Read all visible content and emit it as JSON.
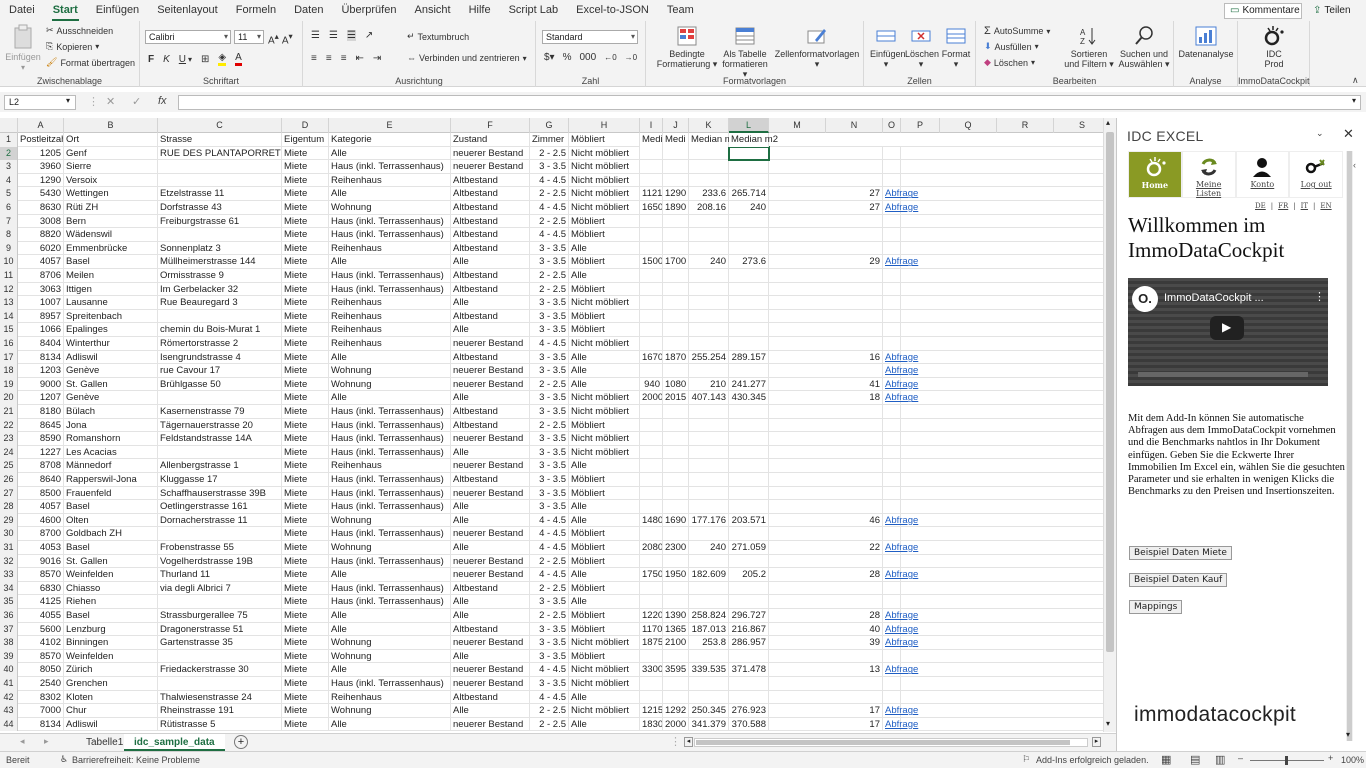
{
  "menu": {
    "tabs": [
      "Datei",
      "Start",
      "Einfügen",
      "Seitenlayout",
      "Formeln",
      "Daten",
      "Überprüfen",
      "Ansicht",
      "Hilfe",
      "Script Lab",
      "Excel-to-JSON",
      "Team"
    ],
    "active": "Start",
    "comments_label": "Kommentare",
    "share_label": "Teilen"
  },
  "ribbon": {
    "clipboard": {
      "paste": "Einfügen",
      "cut": "Ausschneiden",
      "copy": "Kopieren",
      "painter": "Format übertragen",
      "label": "Zwischenablage"
    },
    "font": {
      "name": "Calibri",
      "size": "11",
      "bold": "F",
      "italic": "K",
      "underline": "U",
      "label": "Schriftart"
    },
    "alignment": {
      "wrap": "Textumbruch",
      "merge": "Verbinden und zentrieren",
      "label": "Ausrichtung"
    },
    "number": {
      "format": "Standard",
      "label": "Zahl"
    },
    "styles": {
      "conditional": "Bedingte Formatierung",
      "table": "Als Tabelle formatieren",
      "cell": "Zellenformatvorlagen",
      "label": "Formatvorlagen"
    },
    "cells": {
      "insert": "Einfügen",
      "delete": "Löschen",
      "format": "Format",
      "label": "Zellen"
    },
    "editing": {
      "autosum": "AutoSumme",
      "fill": "Ausfüllen",
      "clear": "Löschen",
      "sort": "Sortieren und Filtern",
      "find": "Suchen und Auswählen",
      "label": "Bearbeiten"
    },
    "analysis": {
      "data": "Datenanalyse",
      "label": "Analyse"
    },
    "idc": {
      "btn": "IDC Prod",
      "label": "ImmoDataCockpit"
    }
  },
  "formula_bar": {
    "namebox": "L2",
    "fx": "fx",
    "value": ""
  },
  "columns": [
    "A",
    "B",
    "C",
    "D",
    "E",
    "F",
    "G",
    "H",
    "I",
    "J",
    "K",
    "L",
    "M",
    "N",
    "O",
    "P",
    "Q",
    "R",
    "S"
  ],
  "selected_cell": "L2",
  "headers": [
    "Postleitzahl",
    "Ort",
    "Strasse",
    "Eigentum",
    "Kategorie",
    "Zustand",
    "Zimmer",
    "Möbliert",
    "Medi",
    "Medi",
    "Median m",
    "Median m2"
  ],
  "rows": [
    [
      "1205",
      "Genf",
      "RUE DES PLANTAPORRETS 7",
      "Miete",
      "Alle",
      "neuerer Bestand",
      "2 - 2.5",
      "Nicht möbliert",
      "",
      "",
      "",
      "",
      "",
      ""
    ],
    [
      "3960",
      "Sierre",
      "",
      "Miete",
      "Haus (inkl. Terrassenhaus)",
      "neuerer Bestand",
      "3 - 3.5",
      "Nicht möbliert",
      "",
      "",
      "",
      "",
      "",
      ""
    ],
    [
      "1290",
      "Versoix",
      "",
      "Miete",
      "Reihenhaus",
      "Altbestand",
      "4 - 4.5",
      "Nicht möbliert",
      "",
      "",
      "",
      "",
      "",
      ""
    ],
    [
      "5430",
      "Wettingen",
      "Etzelstrasse 11",
      "Miete",
      "Alle",
      "Altbestand",
      "2 - 2.5",
      "Nicht möbliert",
      "1121",
      "1290",
      "233.6",
      "265.714",
      "27",
      "Abfrage"
    ],
    [
      "8630",
      "Rüti ZH",
      "Dorfstrasse 43",
      "Miete",
      "Wohnung",
      "Altbestand",
      "4 - 4.5",
      "Nicht möbliert",
      "1650",
      "1890",
      "208.16",
      "240",
      "27",
      "Abfrage"
    ],
    [
      "3008",
      "Bern",
      "Freiburgstrasse 61",
      "Miete",
      "Haus (inkl. Terrassenhaus)",
      "Altbestand",
      "2 - 2.5",
      "Möbliert",
      "",
      "",
      "",
      "",
      "",
      ""
    ],
    [
      "8820",
      "Wädenswil",
      "",
      "Miete",
      "Haus (inkl. Terrassenhaus)",
      "Altbestand",
      "4 - 4.5",
      "Möbliert",
      "",
      "",
      "",
      "",
      "",
      ""
    ],
    [
      "6020",
      "Emmenbrücke",
      "Sonnenplatz 3",
      "Miete",
      "Reihenhaus",
      "Altbestand",
      "3 - 3.5",
      "Alle",
      "",
      "",
      "",
      "",
      "",
      ""
    ],
    [
      "4057",
      "Basel",
      "Müllheimerstrasse 144",
      "Miete",
      "Alle",
      "Alle",
      "3 - 3.5",
      "Möbliert",
      "1500",
      "1700",
      "240",
      "273.6",
      "29",
      "Abfrage"
    ],
    [
      "8706",
      "Meilen",
      "Ormisstrasse 9",
      "Miete",
      "Haus (inkl. Terrassenhaus)",
      "Altbestand",
      "2 - 2.5",
      "Alle",
      "",
      "",
      "",
      "",
      "",
      ""
    ],
    [
      "3063",
      "Ittigen",
      "Im Gerbelacker 32",
      "Miete",
      "Haus (inkl. Terrassenhaus)",
      "Altbestand",
      "2 - 2.5",
      "Möbliert",
      "",
      "",
      "",
      "",
      "",
      ""
    ],
    [
      "1007",
      "Lausanne",
      "Rue Beauregard 3",
      "Miete",
      "Reihenhaus",
      "Alle",
      "3 - 3.5",
      "Nicht möbliert",
      "",
      "",
      "",
      "",
      "",
      ""
    ],
    [
      "8957",
      "Spreitenbach",
      "",
      "Miete",
      "Reihenhaus",
      "Altbestand",
      "3 - 3.5",
      "Möbliert",
      "",
      "",
      "",
      "",
      "",
      ""
    ],
    [
      "1066",
      "Epalinges",
      "chemin du Bois-Murat 1",
      "Miete",
      "Reihenhaus",
      "Alle",
      "3 - 3.5",
      "Möbliert",
      "",
      "",
      "",
      "",
      "",
      ""
    ],
    [
      "8404",
      "Winterthur",
      "Römertorstrasse 2",
      "Miete",
      "Reihenhaus",
      "neuerer Bestand",
      "4 - 4.5",
      "Nicht möbliert",
      "",
      "",
      "",
      "",
      "",
      ""
    ],
    [
      "8134",
      "Adliswil",
      "Isengrundstrasse 4",
      "Miete",
      "Alle",
      "Altbestand",
      "3 - 3.5",
      "Alle",
      "1670",
      "1870",
      "255.254",
      "289.157",
      "16",
      "Abfrage"
    ],
    [
      "1203",
      "Genève",
      "rue Cavour 17",
      "Miete",
      "Wohnung",
      "neuerer Bestand",
      "3 - 3.5",
      "Alle",
      "",
      "",
      "",
      "",
      "",
      "Abfrage"
    ],
    [
      "9000",
      "St. Gallen",
      "Brühlgasse 50",
      "Miete",
      "Wohnung",
      "neuerer Bestand",
      "2 - 2.5",
      "Alle",
      "940",
      "1080",
      "210",
      "241.277",
      "41",
      "Abfrage"
    ],
    [
      "1207",
      "Genève",
      "",
      "Miete",
      "Alle",
      "Alle",
      "3 - 3.5",
      "Nicht möbliert",
      "2000",
      "2015",
      "407.143",
      "430.345",
      "18",
      "Abfrage"
    ],
    [
      "8180",
      "Bülach",
      "Kasernenstrasse 79",
      "Miete",
      "Haus (inkl. Terrassenhaus)",
      "Altbestand",
      "3 - 3.5",
      "Nicht möbliert",
      "",
      "",
      "",
      "",
      "",
      ""
    ],
    [
      "8645",
      "Jona",
      "Tägernauerstrasse 20",
      "Miete",
      "Haus (inkl. Terrassenhaus)",
      "Altbestand",
      "2 - 2.5",
      "Möbliert",
      "",
      "",
      "",
      "",
      "",
      ""
    ],
    [
      "8590",
      "Romanshorn",
      "Feldstandstrasse 14A",
      "Miete",
      "Haus (inkl. Terrassenhaus)",
      "neuerer Bestand",
      "3 - 3.5",
      "Nicht möbliert",
      "",
      "",
      "",
      "",
      "",
      ""
    ],
    [
      "1227",
      "Les Acacias",
      "",
      "Miete",
      "Haus (inkl. Terrassenhaus)",
      "Alle",
      "3 - 3.5",
      "Nicht möbliert",
      "",
      "",
      "",
      "",
      "",
      ""
    ],
    [
      "8708",
      "Männedorf",
      "Allenbergstrasse 1",
      "Miete",
      "Reihenhaus",
      "neuerer Bestand",
      "3 - 3.5",
      "Alle",
      "",
      "",
      "",
      "",
      "",
      ""
    ],
    [
      "8640",
      "Rapperswil-Jona",
      "Kluggasse 17",
      "Miete",
      "Haus (inkl. Terrassenhaus)",
      "Altbestand",
      "3 - 3.5",
      "Möbliert",
      "",
      "",
      "",
      "",
      "",
      ""
    ],
    [
      "8500",
      "Frauenfeld",
      "Schaffhauserstrasse 39B",
      "Miete",
      "Haus (inkl. Terrassenhaus)",
      "neuerer Bestand",
      "3 - 3.5",
      "Möbliert",
      "",
      "",
      "",
      "",
      "",
      ""
    ],
    [
      "4057",
      "Basel",
      "Oetlingerstrasse 161",
      "Miete",
      "Haus (inkl. Terrassenhaus)",
      "Alle",
      "3 - 3.5",
      "Alle",
      "",
      "",
      "",
      "",
      "",
      ""
    ],
    [
      "4600",
      "Olten",
      "Dornacherstrasse 11",
      "Miete",
      "Wohnung",
      "Alle",
      "4 - 4.5",
      "Alle",
      "1480",
      "1690",
      "177.176",
      "203.571",
      "46",
      "Abfrage"
    ],
    [
      "8700",
      "Goldbach ZH",
      "",
      "Miete",
      "Haus (inkl. Terrassenhaus)",
      "neuerer Bestand",
      "4 - 4.5",
      "Möbliert",
      "",
      "",
      "",
      "",
      "",
      ""
    ],
    [
      "4053",
      "Basel",
      "Frobenstrasse 55",
      "Miete",
      "Wohnung",
      "Alle",
      "4 - 4.5",
      "Möbliert",
      "2080",
      "2300",
      "240",
      "271.059",
      "22",
      "Abfrage"
    ],
    [
      "9016",
      "St. Gallen",
      "Vogelherdstrasse 19B",
      "Miete",
      "Haus (inkl. Terrassenhaus)",
      "neuerer Bestand",
      "2 - 2.5",
      "Möbliert",
      "",
      "",
      "",
      "",
      "",
      ""
    ],
    [
      "8570",
      "Weinfelden",
      "Thurland 11",
      "Miete",
      "Alle",
      "neuerer Bestand",
      "4 - 4.5",
      "Alle",
      "1750",
      "1950",
      "182.609",
      "205.2",
      "28",
      "Abfrage"
    ],
    [
      "6830",
      "Chiasso",
      "via degli Albrici 7",
      "Miete",
      "Haus (inkl. Terrassenhaus)",
      "Altbestand",
      "2 - 2.5",
      "Möbliert",
      "",
      "",
      "",
      "",
      "",
      ""
    ],
    [
      "4125",
      "Riehen",
      "",
      "Miete",
      "Haus (inkl. Terrassenhaus)",
      "Alle",
      "3 - 3.5",
      "Alle",
      "",
      "",
      "",
      "",
      "",
      ""
    ],
    [
      "4055",
      "Basel",
      "Strassburgerallee 75",
      "Miete",
      "Alle",
      "Alle",
      "2 - 2.5",
      "Möbliert",
      "1220",
      "1390",
      "258.824",
      "296.727",
      "28",
      "Abfrage"
    ],
    [
      "5600",
      "Lenzburg",
      "Dragonerstrasse 51",
      "Miete",
      "Alle",
      "Altbestand",
      "3 - 3.5",
      "Möbliert",
      "1170",
      "1365",
      "187.013",
      "216.867",
      "40",
      "Abfrage"
    ],
    [
      "4102",
      "Binningen",
      "Gartenstrasse 35",
      "Miete",
      "Wohnung",
      "neuerer Bestand",
      "3 - 3.5",
      "Nicht möbliert",
      "1875",
      "2100",
      "253.8",
      "286.957",
      "39",
      "Abfrage"
    ],
    [
      "8570",
      "Weinfelden",
      "",
      "Miete",
      "Wohnung",
      "Alle",
      "3 - 3.5",
      "Möbliert",
      "",
      "",
      "",
      "",
      "",
      ""
    ],
    [
      "8050",
      "Zürich",
      "Friedackerstrasse 30",
      "Miete",
      "Alle",
      "neuerer Bestand",
      "4 - 4.5",
      "Nicht möbliert",
      "3300",
      "3595",
      "339.535",
      "371.478",
      "13",
      "Abfrage"
    ],
    [
      "2540",
      "Grenchen",
      "",
      "Miete",
      "Haus (inkl. Terrassenhaus)",
      "neuerer Bestand",
      "3 - 3.5",
      "Nicht möbliert",
      "",
      "",
      "",
      "",
      "",
      ""
    ],
    [
      "8302",
      "Kloten",
      "Thalwiesenstrasse 24",
      "Miete",
      "Reihenhaus",
      "Altbestand",
      "4 - 4.5",
      "Alle",
      "",
      "",
      "",
      "",
      "",
      ""
    ],
    [
      "7000",
      "Chur",
      "Rheinstrasse 191",
      "Miete",
      "Wohnung",
      "Alle",
      "2 - 2.5",
      "Nicht möbliert",
      "1215",
      "1292",
      "250.345",
      "276.923",
      "17",
      "Abfrage"
    ],
    [
      "8134",
      "Adliswil",
      "Rütistrasse 5",
      "Miete",
      "Alle",
      "neuerer Bestand",
      "2 - 2.5",
      "Alle",
      "1830",
      "2000",
      "341.379",
      "370.588",
      "17",
      "Abfrage"
    ]
  ],
  "sheets": {
    "tabs": [
      "Tabelle1",
      "idc_sample_data"
    ],
    "active": "idc_sample_data",
    "add": "+"
  },
  "status": {
    "ready": "Bereit",
    "accessibility": "Barrierefreiheit: Keine Probleme",
    "addins": "Add-Ins erfolgreich geladen.",
    "zoom": "100%"
  },
  "pane": {
    "title": "IDC EXCEL",
    "nav": [
      "Home",
      "Meine Listen",
      "Konto",
      "Log out"
    ],
    "nav_active": "Home",
    "langs": [
      "DE",
      "FR",
      "IT",
      "EN"
    ],
    "welcome": "Willkommen im ImmoDataCockpit",
    "video_title": "ImmoDataCockpit ...",
    "description": "Mit dem Add-In können Sie automatische Abfragen aus dem ImmoDataCockpit vornehmen und die Benchmarks nahtlos in Ihr Dokument einfügen. Geben Sie die Eckwerte Ihrer Immobilien Im Excel ein, wählen Sie die gesuchten Parameter und sie erhalten in wenigen Klicks die Benchmarks zu den Preisen und Insertionszeiten.",
    "buttons": [
      "Beispiel Daten Miete",
      "Beispiel Daten Kauf",
      "Mappings"
    ],
    "logo": "immodatacockpit",
    "accent": "#8a9a24"
  },
  "colors": {
    "excel_green": "#1e6e42",
    "link": "#1f5ec4"
  }
}
